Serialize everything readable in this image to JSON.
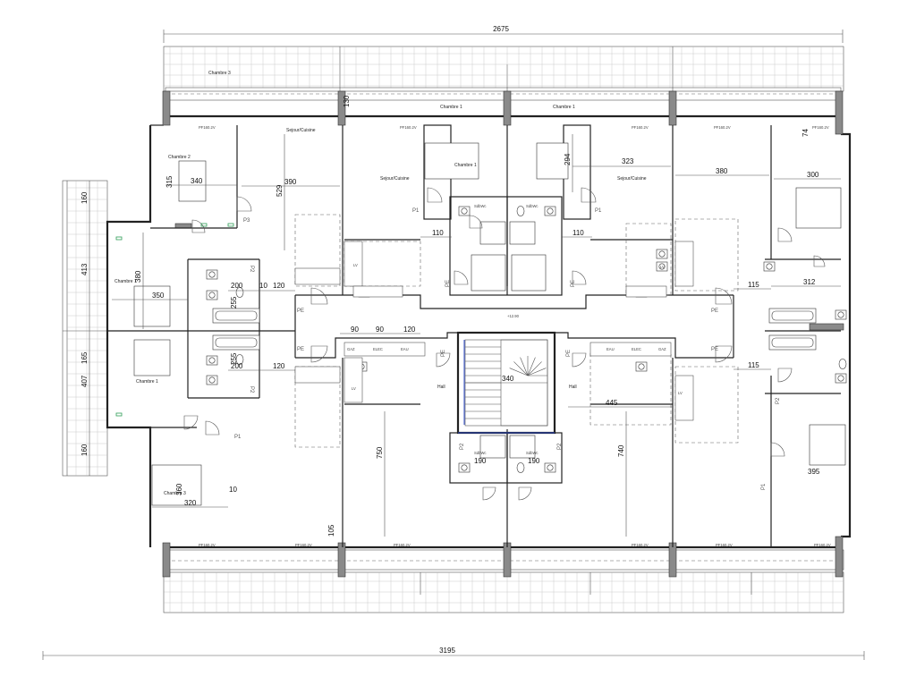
{
  "overall_dimensions": {
    "top": "2675",
    "bottom": "3195"
  },
  "rooms": [
    {
      "id": "chambre-3",
      "label": "Chambre 3"
    },
    {
      "id": "chambre-1-top-left",
      "label": "Chambre 1"
    },
    {
      "id": "chambre-1-top-right",
      "label": "Chambre 1"
    },
    {
      "id": "sejour-cuisine-top",
      "label": "Sejour/Cuisine"
    },
    {
      "id": "chambre-2",
      "label": "Chambre 2"
    },
    {
      "id": "chambre-1-mid-left",
      "label": "Chambre 1"
    },
    {
      "id": "sejour-cuisine-left",
      "label": "Sejour/Cuisine"
    },
    {
      "id": "chambre-1-center",
      "label": "Chambre 1"
    },
    {
      "id": "sejour-cuisine-right",
      "label": "Sejour/Cuisine"
    },
    {
      "id": "chambre-1-west",
      "label": "Chambre 1"
    },
    {
      "id": "chambre-1-lower",
      "label": "Chambre 1"
    },
    {
      "id": "chambre-3-lower",
      "label": "Chambre 3"
    },
    {
      "id": "hall-left",
      "label": "Hall"
    },
    {
      "id": "hall-right",
      "label": "Hall"
    },
    {
      "id": "sdb-1",
      "label": "SdbWc"
    },
    {
      "id": "sdb-2",
      "label": "SdbWc"
    },
    {
      "id": "sdb-3",
      "label": "SdbWc"
    },
    {
      "id": "sdb-4",
      "label": "SdbWc"
    }
  ],
  "dimensions": [
    "340",
    "390",
    "380",
    "300",
    "323",
    "315",
    "529",
    "294",
    "74",
    "130",
    "110",
    "110",
    "350",
    "380",
    "200",
    "120",
    "200",
    "120",
    "115",
    "312",
    "115",
    "90",
    "90",
    "120",
    "340",
    "445",
    "750",
    "740",
    "190",
    "190",
    "320",
    "360",
    "105",
    "395",
    "160",
    "413",
    "165",
    "407",
    "160",
    "255",
    "255",
    "10",
    "10"
  ],
  "labels": {
    "level": "+12.90",
    "pe": "PE",
    "p1": "P1",
    "p2": "P2",
    "p3": "P3",
    "lv": "LV",
    "gaz": "GAZ",
    "elec": "ELEC",
    "eau": "EAU",
    "pf": "PF160.2V",
    "sdbwc": "SdbWc"
  }
}
